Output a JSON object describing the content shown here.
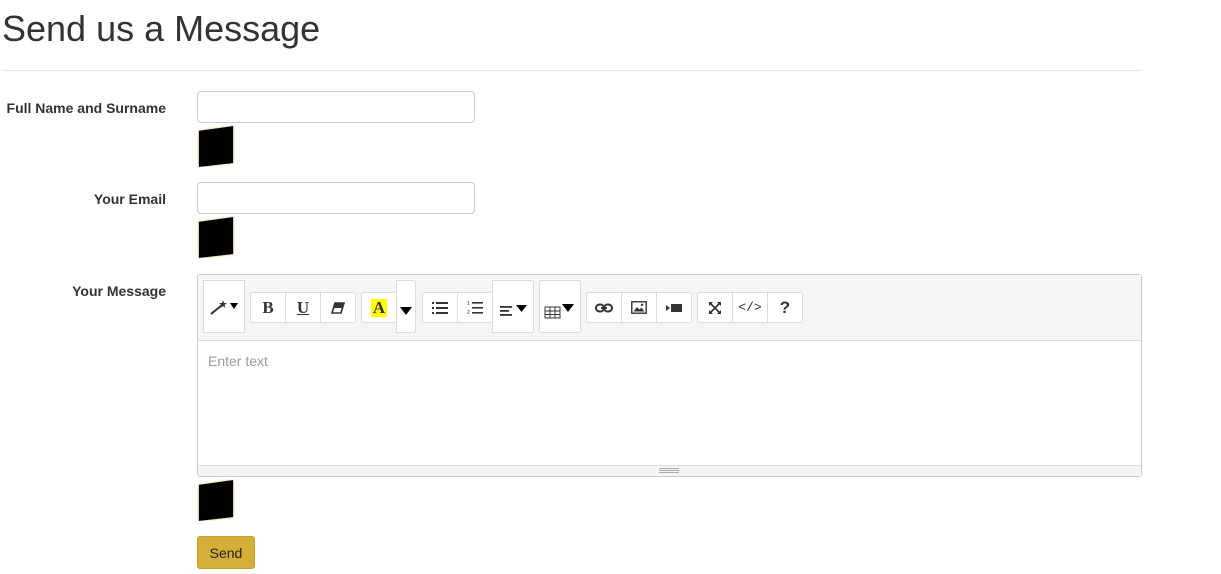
{
  "page": {
    "title": "Send us a Message"
  },
  "form": {
    "name_label": "Full Name and Surname",
    "name_value": "",
    "email_label": "Your Email",
    "email_value": "",
    "message_label": "Your Message",
    "message_placeholder": "Enter text",
    "send_label": "Send"
  },
  "editor_toolbar": {
    "bold": "B",
    "underline": "U",
    "help": "?",
    "code_view": "</>",
    "font_color_letter": "A",
    "highlight_color": "#ffff00"
  },
  "colors": {
    "send_button": "#d4af37",
    "captcha": "#000000"
  }
}
